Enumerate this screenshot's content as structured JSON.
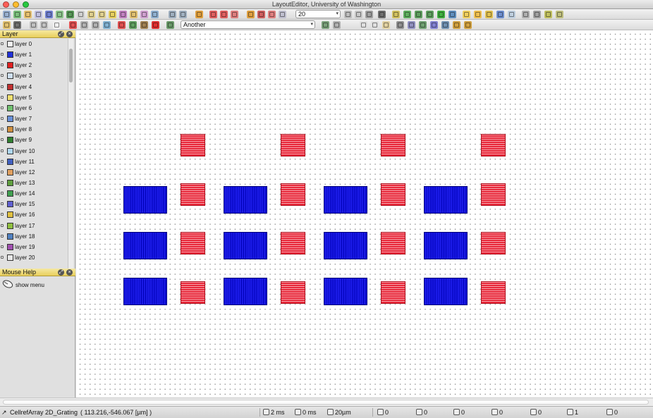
{
  "window": {
    "title": "LayoutEditor, University of Washington"
  },
  "toolbar": {
    "grid_value": "20",
    "cell_select": "Another"
  },
  "layer_panel": {
    "title": "Layer",
    "layers": [
      {
        "name": "layer 0",
        "color": "#f2f2f2"
      },
      {
        "name": "layer 1",
        "color": "#2030d8"
      },
      {
        "name": "layer 2",
        "color": "#e02020"
      },
      {
        "name": "layer 3",
        "color": "#cfe0f0"
      },
      {
        "name": "layer 4",
        "color": "#c03030"
      },
      {
        "name": "layer 5",
        "color": "#f0e070"
      },
      {
        "name": "layer 6",
        "color": "#70c070"
      },
      {
        "name": "layer 7",
        "color": "#6890d8"
      },
      {
        "name": "layer 8",
        "color": "#d09040"
      },
      {
        "name": "layer 9",
        "color": "#308030"
      },
      {
        "name": "layer 10",
        "color": "#b0d8f0"
      },
      {
        "name": "layer 11",
        "color": "#4060c0"
      },
      {
        "name": "layer 12",
        "color": "#e0a060"
      },
      {
        "name": "layer 13",
        "color": "#60a040"
      },
      {
        "name": "layer 14",
        "color": "#40a050"
      },
      {
        "name": "layer 15",
        "color": "#6060d0"
      },
      {
        "name": "layer 16",
        "color": "#e0c040"
      },
      {
        "name": "layer 17",
        "color": "#90c040"
      },
      {
        "name": "layer 18",
        "color": "#5080c0"
      },
      {
        "name": "layer 19",
        "color": "#a050b0"
      },
      {
        "name": "layer 20",
        "color": "#e8e8e8"
      }
    ]
  },
  "mouse_help": {
    "title": "Mouse Help",
    "text": "show menu"
  },
  "statusbar": {
    "mode": "CellrefArray 2D_Grating",
    "coords": "( 113.216,-546.067 [µm] )",
    "time_paint": "2 ms",
    "time_other": "0 ms",
    "grid": "20µm",
    "angle": "0",
    "count_a": "0",
    "count_b": "0",
    "count_c": "0",
    "count_d": "0",
    "layer_count": "1",
    "text_count": "0"
  },
  "colors": {
    "cell_blue": "#1a1ae6",
    "cell_red": "#e8283a",
    "panel_header": "#e9cf5d"
  }
}
